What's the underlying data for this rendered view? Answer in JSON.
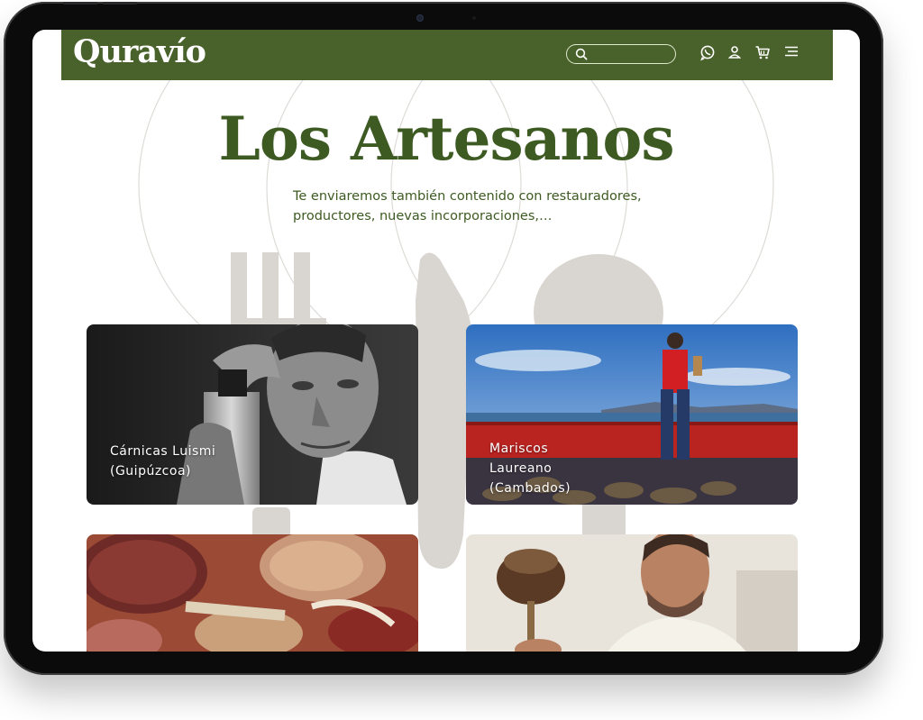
{
  "brand": {
    "logo_text": "Quravío",
    "primary_color": "#49612a",
    "title_color": "#3d5a22"
  },
  "header": {
    "search": {
      "placeholder": ""
    },
    "icons": [
      "whatsapp-icon",
      "user-icon",
      "cart-icon",
      "menu-icon"
    ]
  },
  "hero": {
    "title": "Los Artesanos",
    "subtitle_line1": "Te enviaremos también contenido con restauradores,",
    "subtitle_line2": "productores, nuevas incorporaciones,…"
  },
  "artisans": [
    {
      "line1": "Cárnicas Luismi",
      "line2": "(Guipúzcoa)",
      "line3": ""
    },
    {
      "line1": "Mariscos",
      "line2": "Laureano",
      "line3": "(Cambados)"
    },
    {
      "line1": "",
      "line2": "",
      "line3": ""
    },
    {
      "line1": "",
      "line2": "",
      "line3": ""
    }
  ]
}
